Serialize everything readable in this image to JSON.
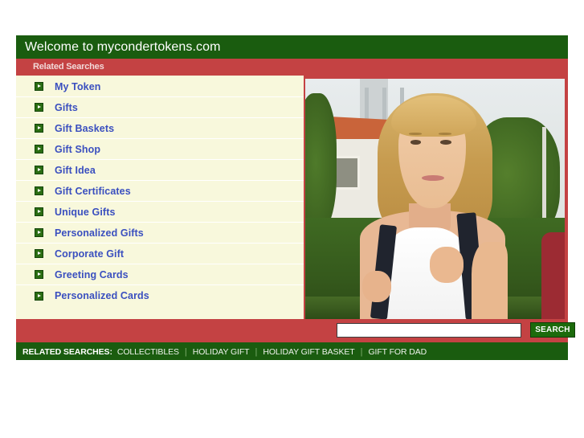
{
  "header": {
    "title": "Welcome to mycondertokens.com",
    "subheader": "Related Searches"
  },
  "colors": {
    "header_green": "#1a5c0f",
    "accent_red": "#c44243",
    "sidebar_cream": "#f8f8dc",
    "link_blue": "#3a4fbf",
    "button_green": "#1c6b0c"
  },
  "sidebar": {
    "items": [
      {
        "label": "My Token",
        "icon": "arrow-right-icon"
      },
      {
        "label": "Gifts",
        "icon": "arrow-right-icon"
      },
      {
        "label": "Gift Baskets",
        "icon": "arrow-right-icon"
      },
      {
        "label": "Gift Shop",
        "icon": "arrow-right-icon"
      },
      {
        "label": "Gift Idea",
        "icon": "arrow-right-icon"
      },
      {
        "label": "Gift Certificates",
        "icon": "arrow-right-icon"
      },
      {
        "label": "Unique Gifts",
        "icon": "arrow-right-icon"
      },
      {
        "label": "Personalized Gifts",
        "icon": "arrow-right-icon"
      },
      {
        "label": "Corporate Gift",
        "icon": "arrow-right-icon"
      },
      {
        "label": "Greeting Cards",
        "icon": "arrow-right-icon"
      },
      {
        "label": "Personalized Cards",
        "icon": "arrow-right-icon"
      }
    ]
  },
  "hero": {
    "alt": "Smiling young blonde woman wearing a backpack outdoors"
  },
  "search": {
    "value": "",
    "placeholder": "",
    "button_label": "SEARCH"
  },
  "footer": {
    "label": "RELATED SEARCHES:",
    "terms": [
      "COLLECTIBLES",
      "HOLIDAY GIFT",
      "HOLIDAY GIFT BASKET",
      "GIFT FOR DAD"
    ],
    "separator": "|"
  }
}
